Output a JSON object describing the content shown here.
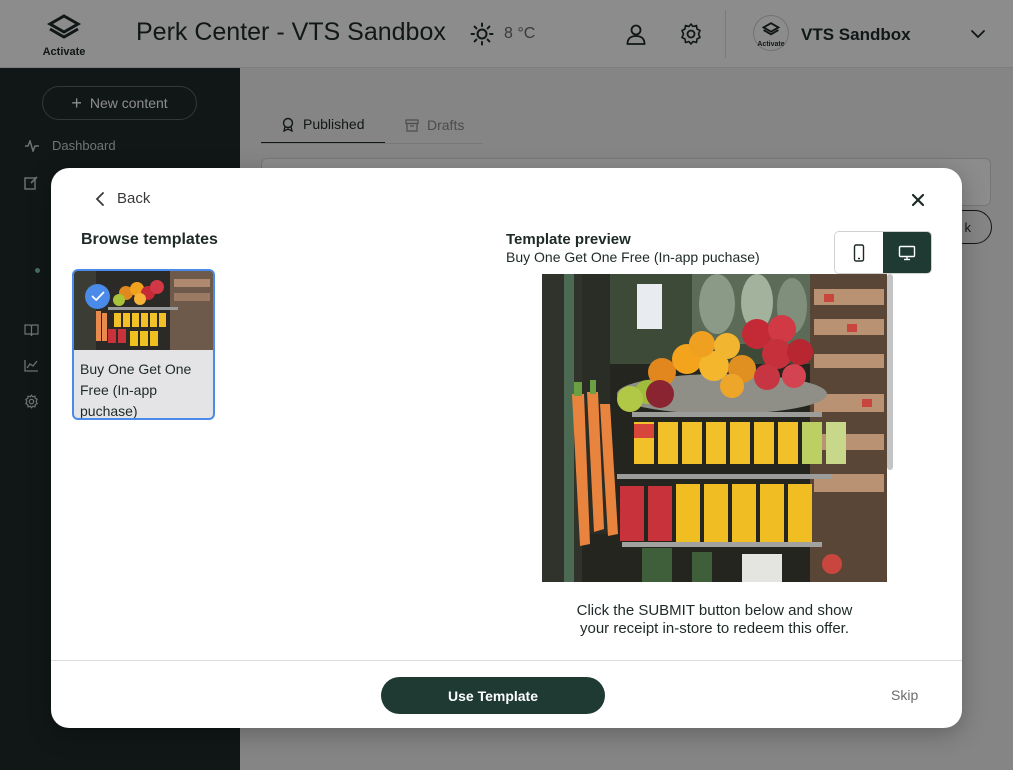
{
  "header": {
    "logo_text": "Activate",
    "title": "Perk Center - VTS Sandbox",
    "weather": "8 °C",
    "org_avatar_text": "Activate",
    "org_name": "VTS Sandbox"
  },
  "sidebar": {
    "new_content": "New content",
    "items": [
      {
        "label": "Dashboard",
        "icon": "activity-icon"
      }
    ]
  },
  "main": {
    "tabs": [
      {
        "label": "Published",
        "icon": "badge-icon"
      },
      {
        "label": "Drafts",
        "icon": "archive-icon"
      }
    ],
    "pill_fragment": "k"
  },
  "modal": {
    "back_label": "Back",
    "browse_title": "Browse templates",
    "templates": [
      {
        "label": "Buy One Get One Free (In-app puchase)",
        "selected": true
      }
    ],
    "preview_title": "Template preview",
    "preview_subtitle": "Buy One Get One Free (In-app puchase)",
    "preview_text": "Click the SUBMIT button below and show your receipt in-store to redeem this offer.",
    "use_template": "Use Template",
    "skip": "Skip"
  },
  "colors": {
    "brand_dark": "#1e3a32",
    "sidebar": "#1e2a28",
    "selection": "#4a8ae8"
  }
}
